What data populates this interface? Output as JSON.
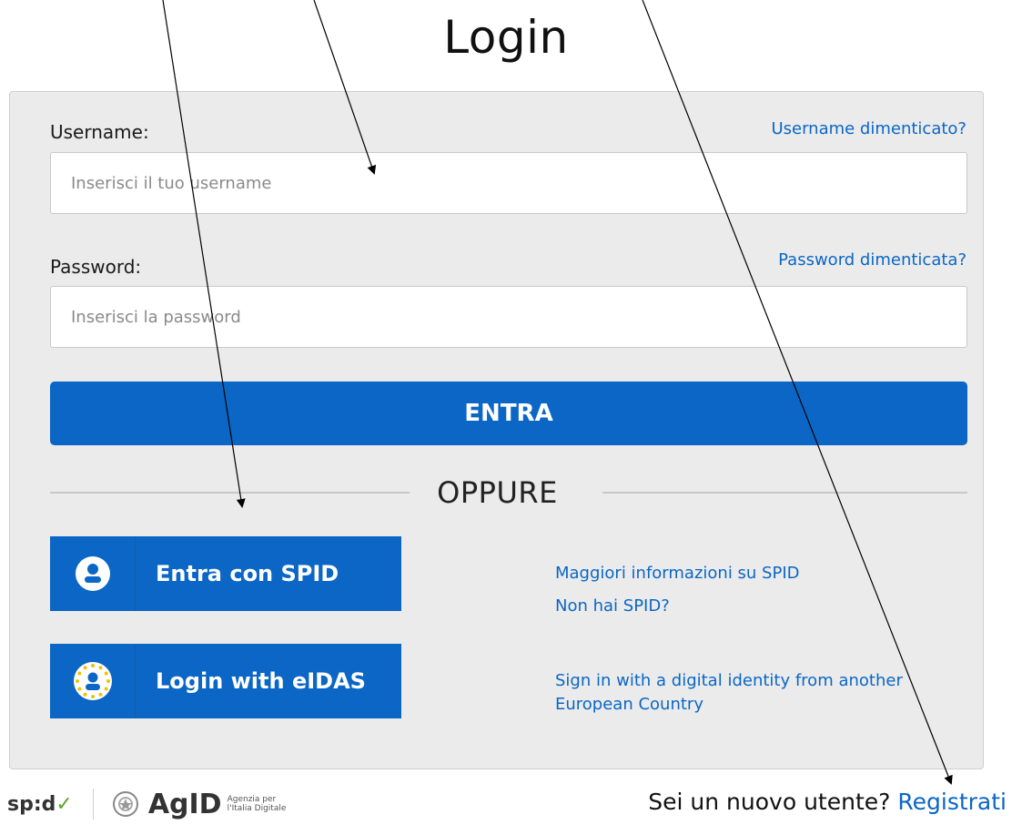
{
  "page": {
    "title": "Login"
  },
  "form": {
    "username_label": "Username:",
    "username_forgot": "Username dimenticato?",
    "username_placeholder": "Inserisci il tuo username",
    "username_value": "",
    "password_label": "Password:",
    "password_forgot": "Password dimenticata?",
    "password_placeholder": "Inserisci la password",
    "password_value": "",
    "submit_label": "ENTRA"
  },
  "divider": {
    "label": "OPPURE"
  },
  "spid": {
    "button_label": "Entra con SPID",
    "icon": "user-icon",
    "more_info": "Maggiori informazioni su SPID",
    "no_spid": "Non hai SPID?"
  },
  "eidas": {
    "button_label": "Login with eIDAS",
    "icon": "eu-stars-user-icon",
    "info_line1": "Sign in with a digital identity from another",
    "info_line2": "European Country"
  },
  "footer": {
    "spid_logo": "sp:d",
    "agid_logo": "AgID",
    "agid_sub1": "Agenzia per",
    "agid_sub2": "l'Italia Digitale",
    "new_user_text": "Sei un nuovo utente?",
    "register_link": "Registrati"
  },
  "colors": {
    "accent": "#0b66c5",
    "card_bg": "#ebebeb",
    "annotation": "#000000"
  }
}
